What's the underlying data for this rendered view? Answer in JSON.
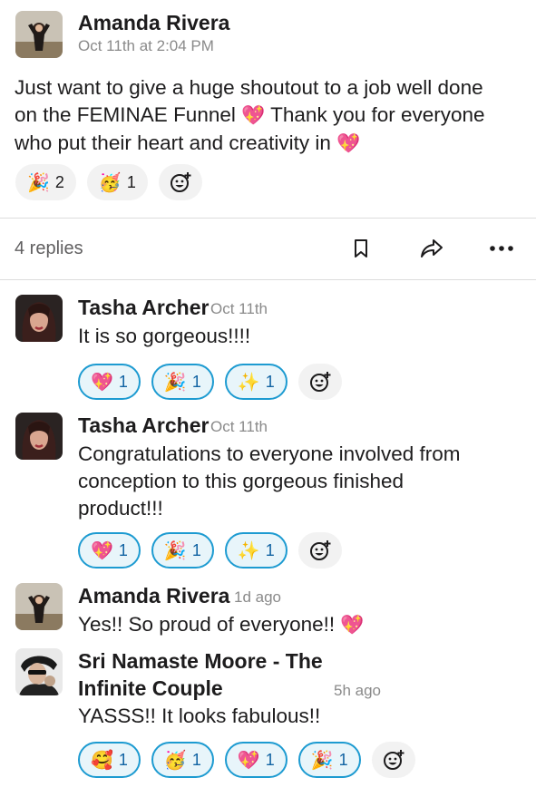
{
  "parent": {
    "author": "Amanda Rivera",
    "timestamp": "Oct 11th at 2:04 PM",
    "text_line1": "Just want to give a huge shoutout to a job well done",
    "text_line2a": "on the FEMINAE Funnel",
    "text_line2b": "Thank you for everyone",
    "text_line3": "who put their heart and creativity in",
    "emoji_heart": "💖",
    "reactions": [
      {
        "emoji": "🎉",
        "count": "2"
      },
      {
        "emoji": "🥳",
        "count": "1"
      }
    ]
  },
  "thread_bar": {
    "replies_label": "4 replies",
    "icons": [
      "bookmark-icon",
      "share-icon",
      "more-icon"
    ]
  },
  "replies": [
    {
      "author": "Tasha Archer",
      "timestamp": "Oct 11th",
      "lines": [
        "It is so gorgeous!!!!"
      ],
      "reactions": [
        {
          "emoji": "💖",
          "count": "1"
        },
        {
          "emoji": "🎉",
          "count": "1"
        },
        {
          "emoji": "✨",
          "count": "1"
        }
      ]
    },
    {
      "author": "Tasha Archer",
      "timestamp": "Oct 11th",
      "lines": [
        "Congratulations to everyone involved from",
        "conception to this gorgeous finished",
        "product!!!"
      ],
      "reactions": [
        {
          "emoji": "💖",
          "count": "1"
        },
        {
          "emoji": "🎉",
          "count": "1"
        },
        {
          "emoji": "✨",
          "count": "1"
        }
      ]
    },
    {
      "author": "Amanda Rivera",
      "timestamp": "1d ago",
      "lines": [
        "Yes!!  So proud of everyone!!"
      ],
      "emoji": "💖"
    },
    {
      "author_line1": "Sri Namaste Moore - The",
      "author_line2": "Infinite Couple",
      "timestamp": "5h ago",
      "lines": [
        "YASSS!! It looks fabulous!!"
      ],
      "reactions": [
        {
          "emoji": "🥰",
          "count": "1"
        },
        {
          "emoji": "🥳",
          "count": "1"
        },
        {
          "emoji": "💖",
          "count": "1"
        },
        {
          "emoji": "🎉",
          "count": "1"
        }
      ]
    }
  ],
  "colors": {
    "reacted_border": "#1d9bd1",
    "reacted_fill": "#e8f5fa",
    "text_muted": "#8a8a8a"
  }
}
